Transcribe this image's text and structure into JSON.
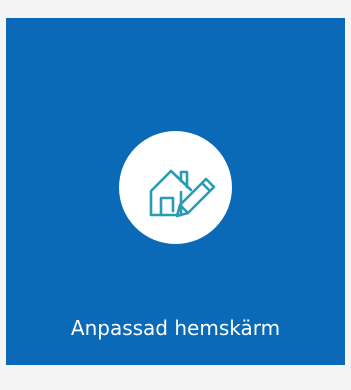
{
  "tile": {
    "label": "Anpassad hemskärm",
    "icon": "custom-home-screen-icon",
    "background_color": "#0b6ab8",
    "icon_color": "#2a9bb5"
  }
}
